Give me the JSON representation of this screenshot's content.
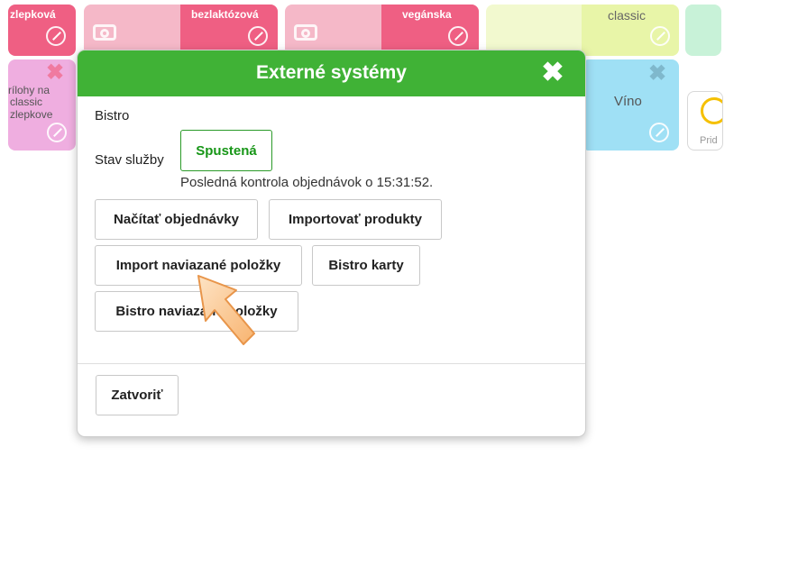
{
  "tiles": {
    "t1_label": "zlepková",
    "t2_label": "bezlaktózová",
    "t3_label": "vegánska",
    "t4_label": "classic",
    "t6_label_1": "rílohy na",
    "t6_label_2": "classic",
    "t6_label_3": "zlepkove",
    "t7_label": "Víno",
    "add_label": "Prid"
  },
  "dialog": {
    "title": "Externé systémy",
    "system_name": "Bistro",
    "service_state_label": "Stav služby",
    "service_state_value": "Spustená",
    "last_check": "Posledná kontrola objednávok o 15:31:52.",
    "buttons": {
      "load_orders": "Načítať objednávky",
      "import_products": "Importovať produkty",
      "import_linked": "Import naviazané položky",
      "bistro_cards": "Bistro karty",
      "bistro_linked": "Bistro naviazané položky"
    },
    "close_label": "Zatvoriť"
  },
  "colors": {
    "header_green": "#40b236",
    "status_green": "#179617",
    "tile_red": "#ef5f83",
    "tile_pink": "#f5b8c8",
    "tile_lime": "#e8f5a8",
    "tile_mint": "#c8f2d8",
    "tile_lilac": "#efaee0",
    "tile_cyan": "#9fe0f5",
    "add_yellow": "#f5c000"
  }
}
